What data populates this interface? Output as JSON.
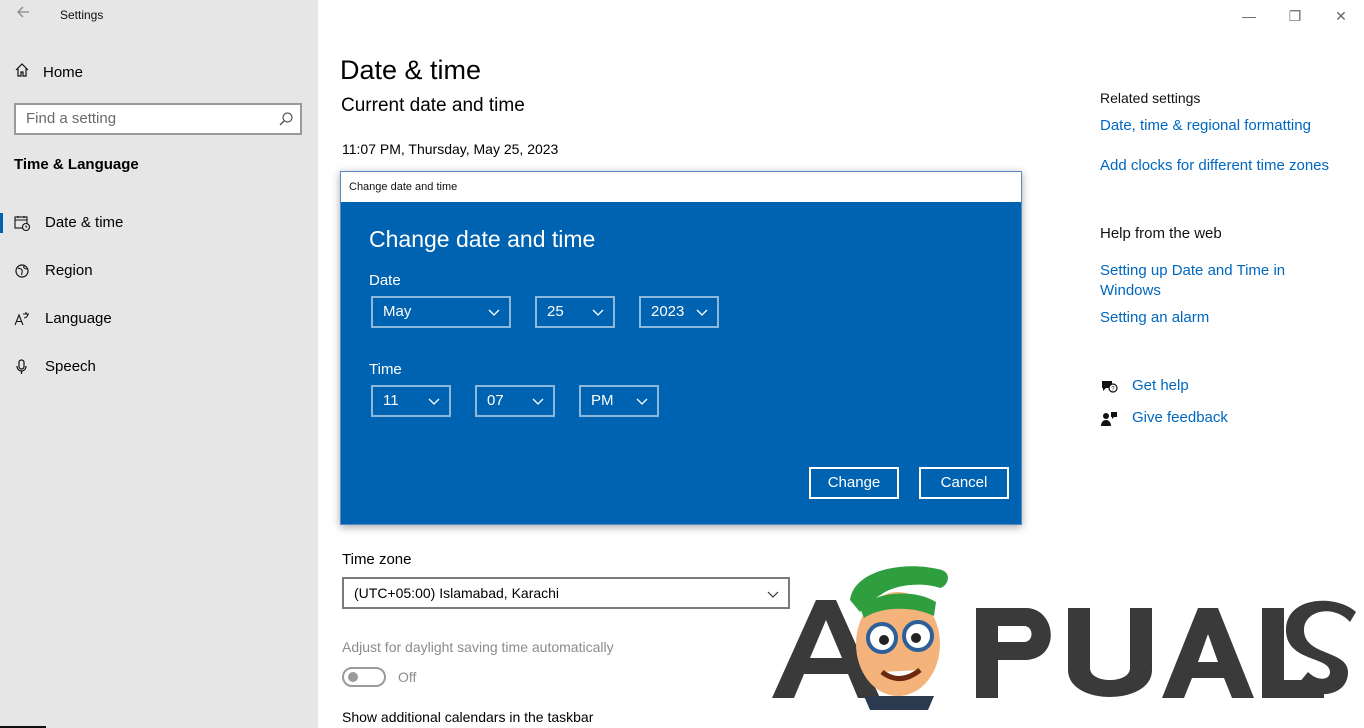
{
  "window": {
    "title": "Settings",
    "controls": {
      "minimize": "—",
      "maximize": "❐",
      "close": "✕"
    }
  },
  "sidebar": {
    "home_label": "Home",
    "search_placeholder": "Find a setting",
    "section_title": "Time & Language",
    "items": [
      {
        "label": "Date & time",
        "icon": "calendar-clock-icon",
        "active": true
      },
      {
        "label": "Region",
        "icon": "globe-icon",
        "active": false
      },
      {
        "label": "Language",
        "icon": "language-icon",
        "active": false
      },
      {
        "label": "Speech",
        "icon": "microphone-icon",
        "active": false
      }
    ]
  },
  "main": {
    "title": "Date & time",
    "subtitle": "Current date and time",
    "current_time": "11:07 PM, Thursday, May 25, 2023",
    "timezone_label": "Time zone",
    "timezone_value": "(UTC+05:00) Islamabad, Karachi",
    "dst_label": "Adjust for daylight saving time automatically",
    "dst_state": "Off",
    "calendars_label": "Show additional calendars in the taskbar"
  },
  "dialog": {
    "window_title": "Change date and time",
    "heading": "Change date and time",
    "date_label": "Date",
    "month": "May",
    "day": "25",
    "year": "2023",
    "time_label": "Time",
    "hour": "11",
    "minute": "07",
    "ampm": "PM",
    "change_button": "Change",
    "cancel_button": "Cancel"
  },
  "related": {
    "heading": "Related settings",
    "links": [
      "Date, time & regional formatting",
      "Add clocks for different time zones"
    ],
    "help_heading": "Help from the web",
    "help_link_1": "Setting up Date and Time in Windows",
    "help_link_2": "Setting an alarm",
    "get_help": "Get help",
    "give_feedback": "Give feedback"
  },
  "watermark": {
    "text": "APPUALS"
  },
  "colors": {
    "accent": "#0063b1",
    "link": "#0067c0",
    "sidebar_bg": "#e6e6e6"
  }
}
